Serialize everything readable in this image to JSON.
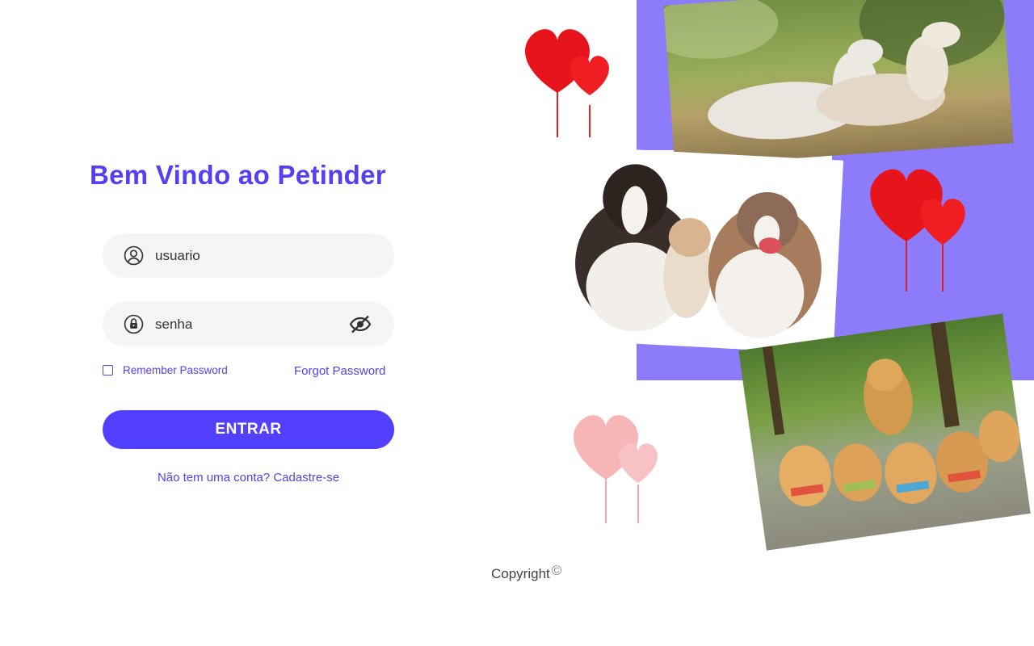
{
  "login": {
    "title": "Bem Vindo ao Petinder",
    "user_placeholder": "usuario",
    "password_placeholder": "senha",
    "remember_label": "Remember Password",
    "forgot_label": "Forgot Password",
    "submit_label": "ENTRAR",
    "signup_label": "Não tem uma conta? Cadastre-se"
  },
  "footer": {
    "copyright_label": "Copyright",
    "copyright_symbol": "©"
  },
  "icons": {
    "user": "user-circle-icon",
    "lock": "lock-icon",
    "visibility": "eye-off-icon",
    "balloon": "heart-balloon-icon"
  },
  "colors": {
    "brand": "#5340f5",
    "button": "#5340ff",
    "panel": "#8c7cfb",
    "field_bg": "#f5f5f5",
    "heart_red": "#e8141b",
    "heart_pink": "#f6b6b8"
  }
}
